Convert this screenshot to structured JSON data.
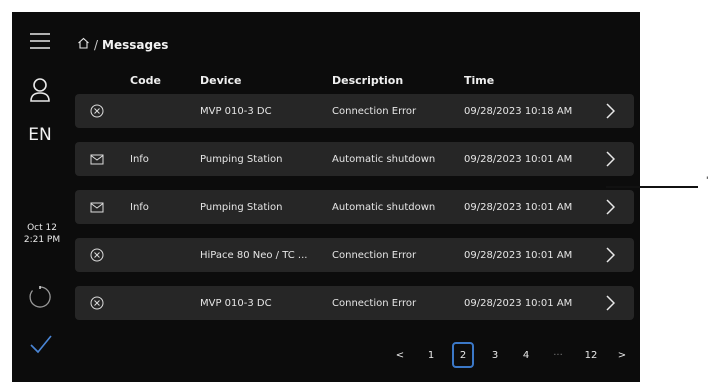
{
  "header": {
    "breadcrumb_home_icon": "home-icon",
    "separator": "/",
    "title": "Messages"
  },
  "sidebar": {
    "menu_icon": "hamburger-menu-icon",
    "user_icon": "user-icon",
    "language": "EN",
    "date": "Oct 12",
    "time": "2:21 PM",
    "spinner_icon": "loading-spinner-icon",
    "confirm_icon": "checkmark-icon"
  },
  "table": {
    "columns": {
      "code": "Code",
      "device": "Device",
      "description": "Description",
      "time": "Time"
    },
    "rows": [
      {
        "status_icon": "error-x-circle-icon",
        "code": "",
        "device": "MVP 010-3 DC",
        "description": "Connection Error",
        "time": "09/28/2023 10:18 AM"
      },
      {
        "status_icon": "envelope-icon",
        "code": "Info",
        "device": "Pumping Station",
        "description": "Automatic shutdown",
        "time": "09/28/2023 10:01 AM"
      },
      {
        "status_icon": "envelope-icon",
        "code": "Info",
        "device": "Pumping Station",
        "description": "Automatic shutdown",
        "time": "09/28/2023 10:01 AM"
      },
      {
        "status_icon": "error-x-circle-icon",
        "code": "",
        "device": "HiPace 80 Neo / TC ...",
        "description": "Connection Error",
        "time": "09/28/2023 10:01 AM"
      },
      {
        "status_icon": "error-x-circle-icon",
        "code": "",
        "device": "MVP 010-3 DC",
        "description": "Connection Error",
        "time": "09/28/2023 10:01 AM"
      }
    ]
  },
  "pagination": {
    "prev": "<",
    "pages": [
      "1",
      "2",
      "3",
      "4"
    ],
    "ellipsis": "···",
    "last": "12",
    "next": ">",
    "current": "2"
  },
  "annotation": {
    "marker": "'"
  },
  "colors": {
    "screen_bg": "#0c0c0c",
    "row_bg": "#262626",
    "accent": "#3b78c8"
  }
}
